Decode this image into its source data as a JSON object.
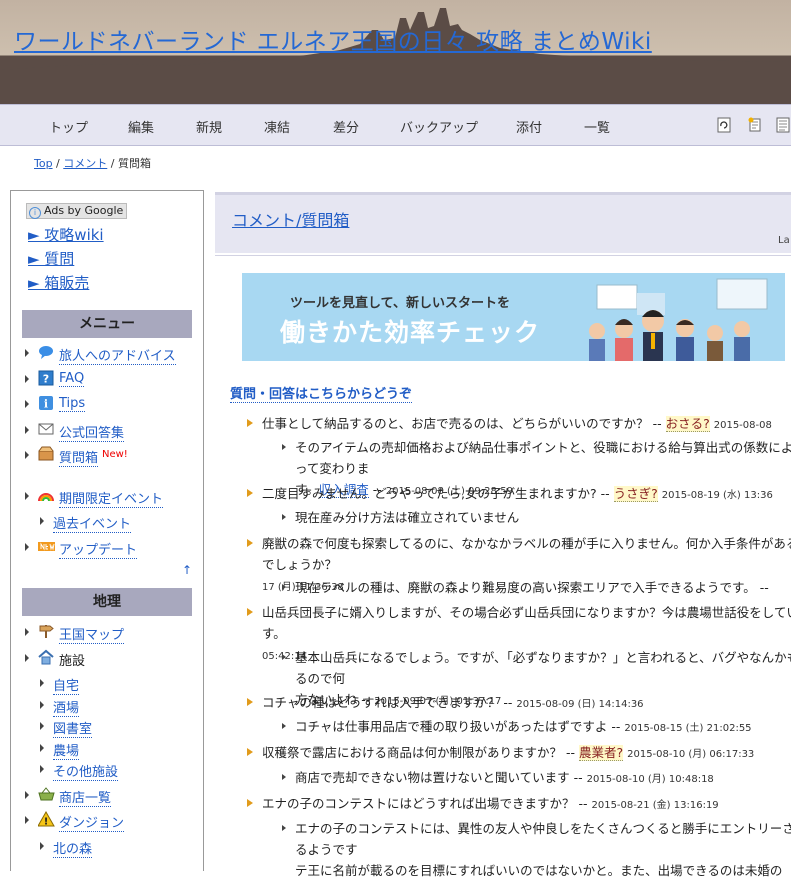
{
  "header": {
    "site_title": "ワールドネバーランド エルネア王国の日々 攻略 まとめWiki"
  },
  "nav": {
    "items": [
      "トップ",
      "編集",
      "新規",
      "凍結",
      "差分",
      "バックアップ",
      "添付",
      "一覧"
    ],
    "tool_icons": [
      "reload-icon",
      "new-page-icon",
      "page-list-icon"
    ]
  },
  "breadcrumb": {
    "top": "Top",
    "mid": "コメント",
    "current": "質問箱"
  },
  "sidebar": {
    "ads_label": "Ads by Google",
    "ads_info": "i",
    "ad_links": [
      "► 攻略wiki",
      "► 質問",
      "► 箱販売"
    ],
    "menu_heading": "メニュー",
    "menu_items": [
      {
        "label": "旅人へのアドバイス",
        "icon": "speech-bubble-icon"
      },
      {
        "label": "FAQ",
        "icon": "question-icon"
      },
      {
        "label": "Tips",
        "icon": "info-icon"
      },
      {
        "label": "公式回答集",
        "icon": "mail-icon"
      },
      {
        "label": "質問箱",
        "icon": "mailbox-icon",
        "badge": "New!"
      },
      {
        "label": "期間限定イベント",
        "icon": "rainbow-icon"
      },
      {
        "label": "過去イベント"
      },
      {
        "label": "アップデート",
        "icon": "new-badge-icon"
      }
    ],
    "to_top": "↑",
    "geo_heading": "地理",
    "geo_items": [
      {
        "label": "王国マップ",
        "icon": "signpost-icon"
      },
      {
        "label": "施設",
        "icon": "house-icon"
      },
      {
        "label": "自宅"
      },
      {
        "label": "酒場"
      },
      {
        "label": "図書室"
      },
      {
        "label": "農場"
      },
      {
        "label": "その他施設"
      },
      {
        "label": "商店一覧",
        "icon": "basket-icon"
      },
      {
        "label": "ダンジョン",
        "icon": "warning-icon"
      },
      {
        "label": "北の森"
      }
    ]
  },
  "main": {
    "page_title": "コメント/質問箱",
    "last_modified": "La",
    "banner": {
      "sub": "ツールを見直して、新しいスタートを",
      "main": "働きかた効率チェック"
    },
    "section_link": "質問・回答はこちらからどうぞ"
  },
  "comments": [
    {
      "q": "仕事として納品するのと、お店で売るのは、どちらがいいのですか？ --",
      "name": "おさる?",
      "date": "2015-08-08"
    },
    {
      "a": "そのアイテムの売却価格および納品仕事ポイントと、役職における給与算出式の係数によって変わりま",
      "a2": "す。",
      "name": "収入調査",
      "date": "2015-08-08 (土) 09:28:59"
    },
    {
      "q": "二度目すみません。どうやってたら,女の子が生まれますか? --",
      "name": "うさぎ?",
      "date": "2015-08-19 (水) 13:36"
    },
    {
      "a": "現在産み分け方法は確立されていません"
    },
    {
      "q": "廃獣の森で何度も探索してるのに、なかなかラベルの種が手に入りません。何か入手条件があるのでしょうか？",
      "q2": "17 (月) 11:36:38"
    },
    {
      "a": "現在ラベルの種は、廃獣の森より難易度の高い探索エリアで入手できるようです。 --"
    },
    {
      "q": "山岳兵団長子に婿入りしますが、その場合必ず山岳兵団になりますか？今は農場世話役をしています。",
      "q2": "05:42:14"
    },
    {
      "a": "基本山岳兵になるでしょう。ですが、「必ずなりますか？」と言われると、バグやなんかもあるので何",
      "a2": "方ないよね --",
      "date": "2015-09-07 (月) 01:37:17"
    },
    {
      "q": "コチャの種はどうすれば入手できますか？ --",
      "date": "2015-08-09 (日) 14:14:36"
    },
    {
      "a": "コチャは仕事用品店で種の取り扱いがあったはずですよ --",
      "date": "2015-08-15 (土) 21:02:55"
    },
    {
      "q": "収穫祭で露店における商品は何か制限がありますか？ --",
      "name": "農業者?",
      "date": "2015-08-10 (月) 06:17:33"
    },
    {
      "a": "商店で売却できない物は置けないと聞いています --",
      "date": "2015-08-10 (月) 10:48:18"
    },
    {
      "q": "エナの子のコンテストにはどうすれば出場できますか？ --",
      "date": "2015-08-21 (金) 13:16:19"
    },
    {
      "a": "エナの子のコンテストには、異性の友人や仲良しをたくさんつくると勝手にエントリーされるようです",
      "a2": "テ王に名前が載るのを目標にすればいいのではないかと。また、出場できるのは未婚の"
    }
  ]
}
